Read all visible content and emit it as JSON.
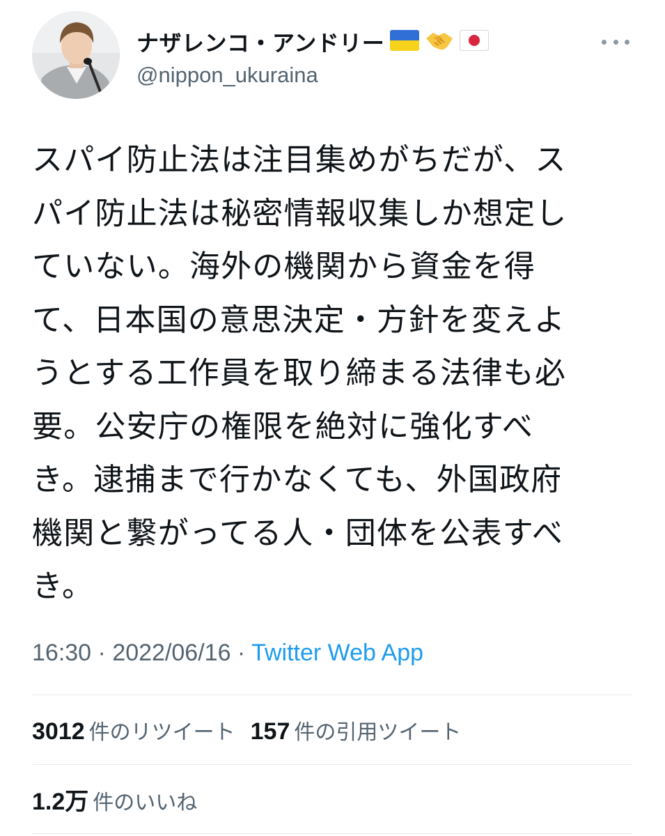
{
  "author": {
    "display_name": "ナザレンコ・アンドリー",
    "handle": "@nippon_ukuraina",
    "emoji": [
      "ukraine-flag-icon",
      "handshake-icon",
      "japan-flag-icon"
    ]
  },
  "tweet": {
    "lines": [
      "スパイ防止法は注目集めがちだが、ス",
      "パイ防止法は秘密情報収集しか想定し",
      "ていない。海外の機関から資金を得",
      "て、日本国の意思決定・方針を変えよ",
      "うとする工作員を取り締まる法律も必",
      "要。公安庁の権限を絶対に強化すべ",
      "き。逮捕まで行かなくても、外国政府",
      "機関と繋がってる人・団体を公表すべ",
      "き。"
    ],
    "time": "16:30",
    "separator": " · ",
    "date": "2022/06/16",
    "source": "Twitter Web App"
  },
  "stats": {
    "retweets_count": "3012",
    "retweets_label": "件のリツイート",
    "quotes_count": "157",
    "quotes_label": "件の引用ツイート",
    "likes_count": "1.2万",
    "likes_label": "件のいいね"
  },
  "colors": {
    "text": "#0f1419",
    "secondary": "#536471",
    "link": "#1d9bf0",
    "divider": "#e6e9eb"
  }
}
